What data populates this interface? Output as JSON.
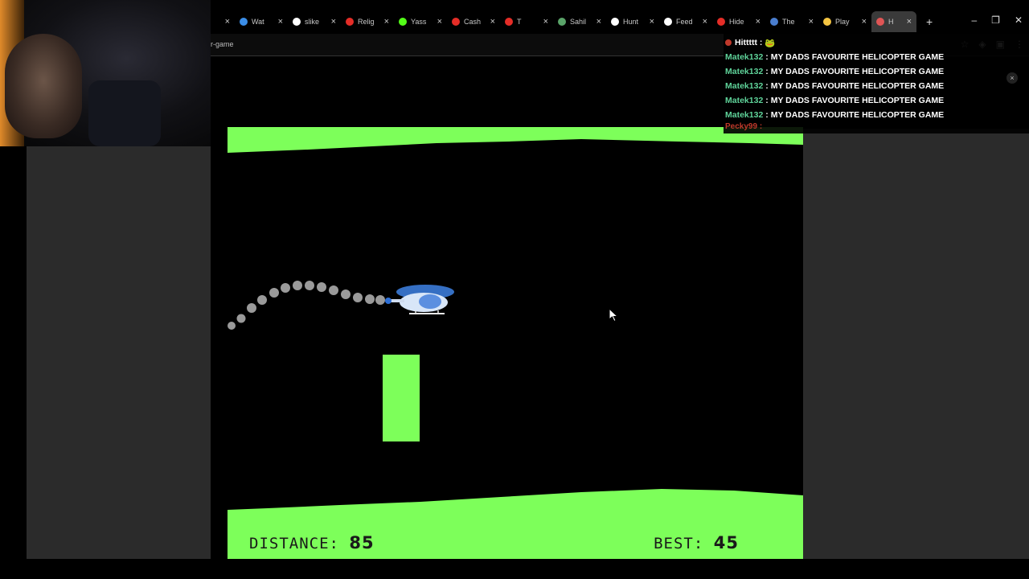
{
  "browser": {
    "tabs": [
      {
        "title": "",
        "favicon_color": "#888888",
        "active": false
      },
      {
        "title": "Wat",
        "favicon_color": "#3b8ee8",
        "active": false
      },
      {
        "title": "slike",
        "favicon_color": "#ffffff",
        "active": false
      },
      {
        "title": "Relig",
        "favicon_color": "#e52d27",
        "active": false
      },
      {
        "title": "Yass",
        "favicon_color": "#53fc18",
        "active": false
      },
      {
        "title": "Cash",
        "favicon_color": "#e52d27",
        "active": false
      },
      {
        "title": "T",
        "favicon_color": "#e52d27",
        "active": false
      },
      {
        "title": "Sahil",
        "favicon_color": "#5aa469",
        "active": false
      },
      {
        "title": "Hunt",
        "favicon_color": "#ffffff",
        "active": false
      },
      {
        "title": "Feed",
        "favicon_color": "#ffffff",
        "active": false
      },
      {
        "title": "Hide",
        "favicon_color": "#e52d27",
        "active": false
      },
      {
        "title": "The",
        "favicon_color": "#4a7ecf",
        "active": false
      },
      {
        "title": "Play",
        "favicon_color": "#f5c542",
        "active": false
      },
      {
        "title": "H",
        "favicon_color": "#e05555",
        "active": true
      }
    ],
    "new_tab_label": "+",
    "url_fragment": "r-game",
    "window_controls": {
      "minimize": "–",
      "restore": "❐",
      "close": "✕"
    }
  },
  "chat": {
    "first_user": "Hittttt :",
    "messages": [
      {
        "user": "Matek132",
        "text": ": MY DADS FAVOURITE HELICOPTER GAME"
      },
      {
        "user": "Matek132",
        "text": ": MY DADS FAVOURITE HELICOPTER GAME"
      },
      {
        "user": "Matek132",
        "text": ": MY DADS FAVOURITE HELICOPTER GAME"
      },
      {
        "user": "Matek132",
        "text": ": MY DADS FAVOURITE HELICOPTER GAME"
      },
      {
        "user": "Matek132",
        "text": ": MY DADS FAVOURITE HELICOPTER GAME"
      }
    ],
    "last_user": "Pecky99 :",
    "close_label": "×"
  },
  "game": {
    "distance_label": "DISTANCE:",
    "distance_value": "85",
    "best_label": "BEST:",
    "best_value": "45",
    "terrain_color": "#7dff5a",
    "obstacle_color": "#7dff5a"
  }
}
